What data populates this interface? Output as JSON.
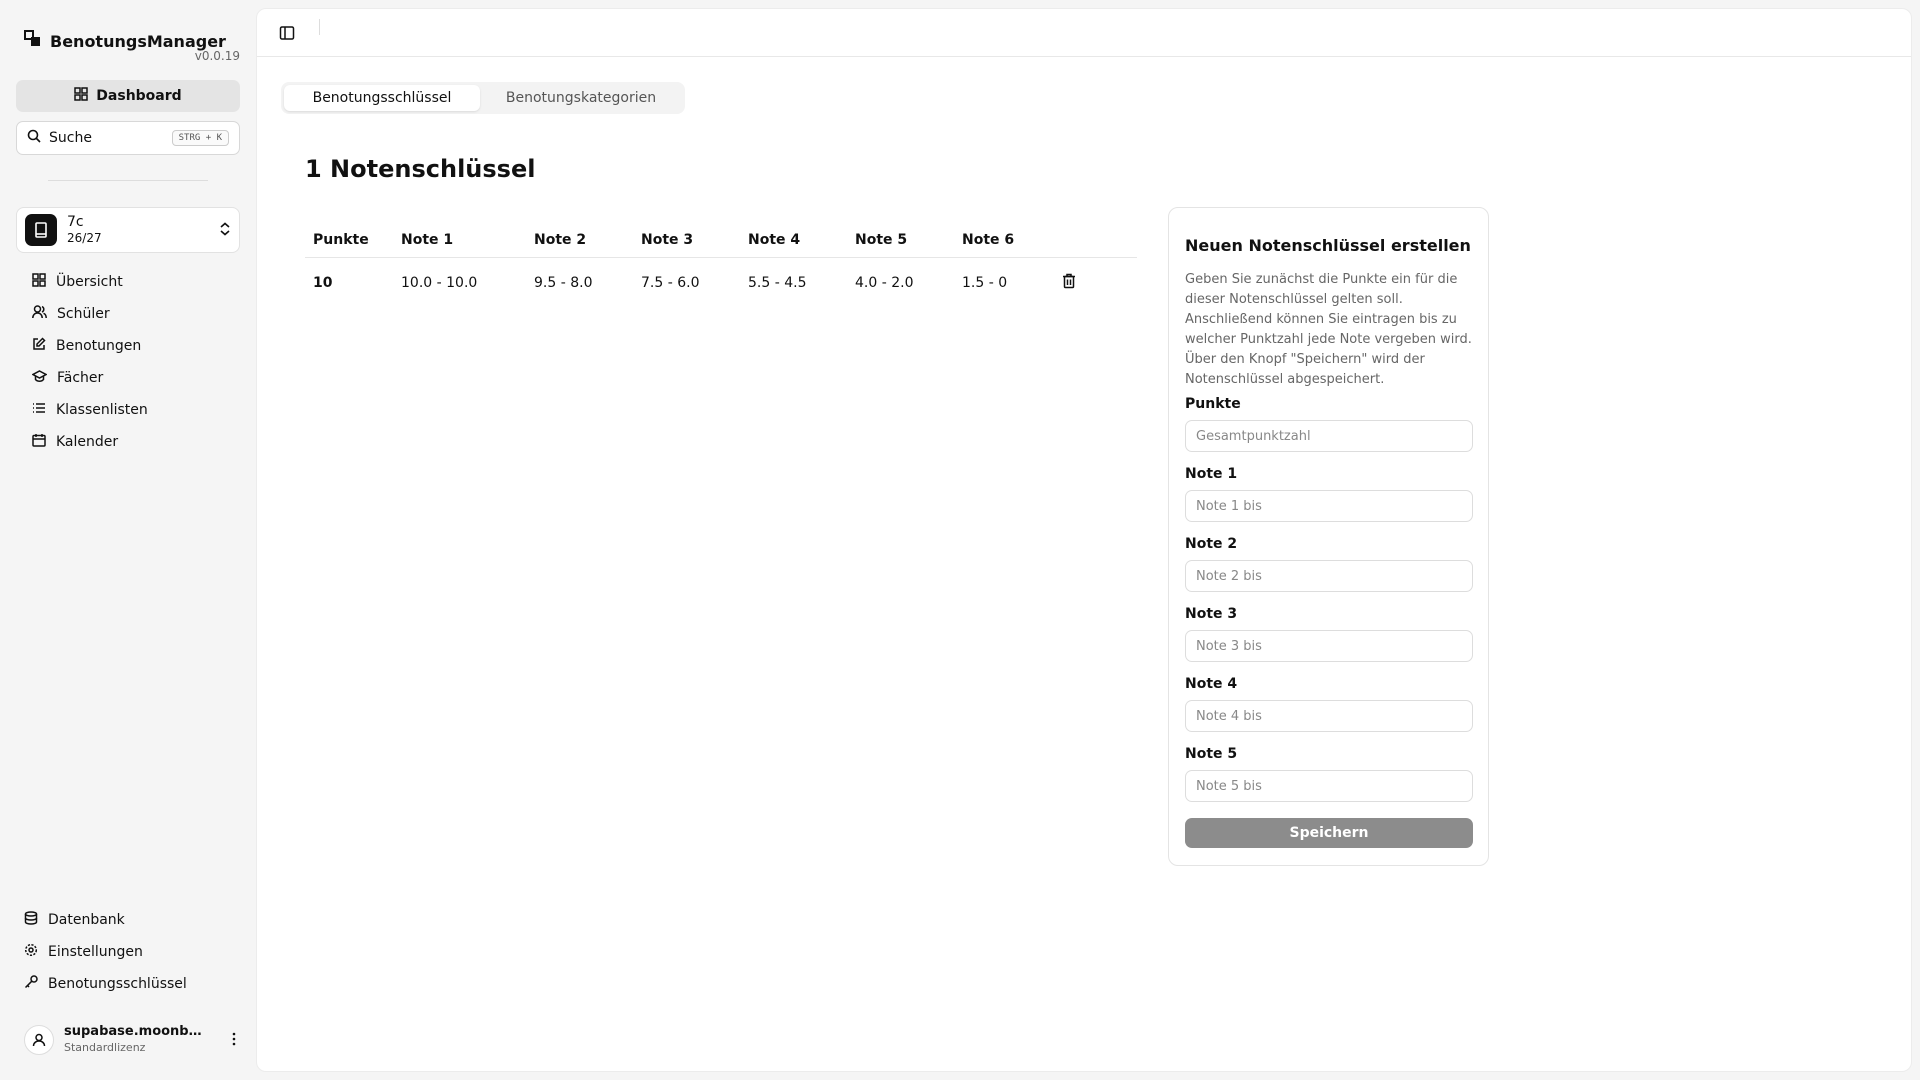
{
  "app": {
    "name": "BenotungsManager",
    "version": "v0.0.19"
  },
  "sidebar": {
    "dashboard_label": "Dashboard",
    "search": {
      "label": "Suche",
      "shortcut": "STRG + K"
    },
    "class": {
      "name": "7c",
      "count": "26/27"
    },
    "nav": [
      {
        "label": "Übersicht",
        "icon": "grid-icon"
      },
      {
        "label": "Schüler",
        "icon": "users-icon"
      },
      {
        "label": "Benotungen",
        "icon": "edit-icon"
      },
      {
        "label": "Fächer",
        "icon": "graduation-cap-icon"
      },
      {
        "label": "Klassenlisten",
        "icon": "list-icon"
      },
      {
        "label": "Kalender",
        "icon": "calendar-icon"
      }
    ],
    "bottom_nav": [
      {
        "label": "Datenbank",
        "icon": "database-icon"
      },
      {
        "label": "Einstellungen",
        "icon": "gear-icon"
      },
      {
        "label": "Benotungsschlüssel",
        "icon": "key-icon"
      }
    ],
    "user": {
      "name": "supabase.moonbea...",
      "license": "Standardlizenz"
    }
  },
  "main": {
    "tabs": [
      {
        "label": "Benotungsschlüssel",
        "active": true
      },
      {
        "label": "Benotungskategorien",
        "active": false
      }
    ],
    "title": "1 Notenschlüssel",
    "table": {
      "headers": [
        "Punkte",
        "Note 1",
        "Note 2",
        "Note 3",
        "Note 4",
        "Note 5",
        "Note 6"
      ],
      "rows": [
        [
          "10",
          "10.0 - 10.0",
          "9.5 - 8.0",
          "7.5 - 6.0",
          "5.5 - 4.5",
          "4.0 - 2.0",
          "1.5 - 0"
        ]
      ]
    }
  },
  "form": {
    "title": "Neuen Notenschlüssel erstellen",
    "description": "Geben Sie zunächst die Punkte ein für die dieser Notenschlüssel gelten soll. Anschließend können Sie eintragen bis zu welcher Punktzahl jede Note vergeben wird. Über den Knopf \"Speichern\" wird der Notenschlüssel abgespeichert.",
    "fields": [
      {
        "label": "Punkte",
        "placeholder": "Gesamtpunktzahl"
      },
      {
        "label": "Note 1",
        "placeholder": "Note 1 bis"
      },
      {
        "label": "Note 2",
        "placeholder": "Note 2 bis"
      },
      {
        "label": "Note 3",
        "placeholder": "Note 3 bis"
      },
      {
        "label": "Note 4",
        "placeholder": "Note 4 bis"
      },
      {
        "label": "Note 5",
        "placeholder": "Note 5 bis"
      }
    ],
    "save_label": "Speichern"
  },
  "colors": {
    "save_button": "#8c8c8c",
    "class_icon": "#111111"
  }
}
